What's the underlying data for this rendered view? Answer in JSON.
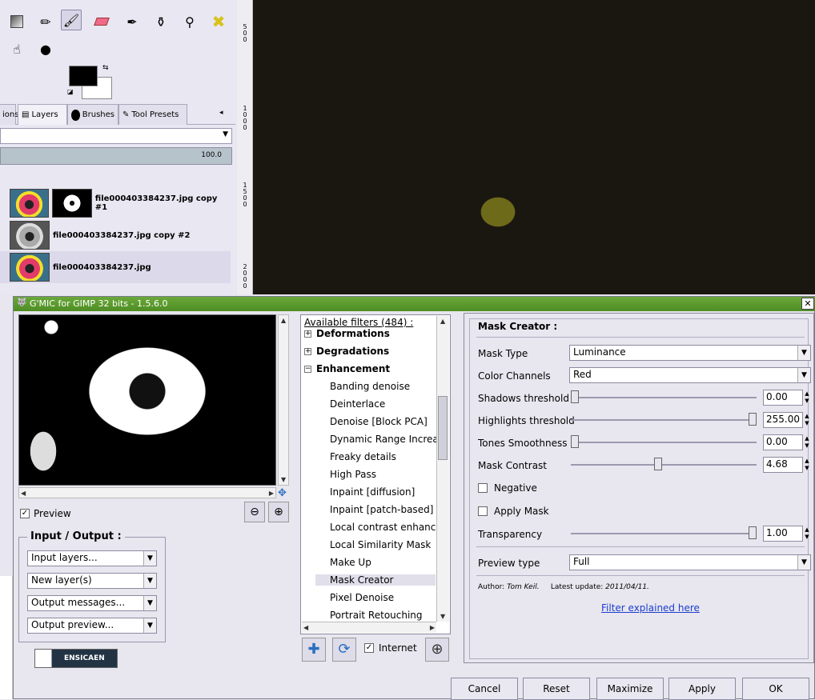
{
  "gimp": {
    "dock_tabs": [
      {
        "label": "ions",
        "icon": "ions-tab-icon"
      },
      {
        "label": "Layers",
        "icon": "layers-icon"
      },
      {
        "label": "Brushes",
        "icon": "brush-icon"
      },
      {
        "label": "Tool Presets",
        "icon": "tool-presets-icon"
      }
    ],
    "opacity": "100.0",
    "layers": [
      {
        "name": "file000403384237.jpg copy #1"
      },
      {
        "name": "file000403384237.jpg copy #2"
      },
      {
        "name": "file000403384237.jpg"
      }
    ],
    "ruler_labels": [
      "5\n0\n0",
      "1\n0\n0\n0",
      "1\n5\n0\n0",
      "2\n0\n0\n0"
    ]
  },
  "gmic": {
    "title": "G'MIC for GIMP 32 bits - 1.5.6.0",
    "close_label": "✕",
    "preview_label": "Preview",
    "io_title": "Input / Output :",
    "io_combos": [
      "Input layers...",
      "New layer(s)",
      "Output messages...",
      "Output preview..."
    ],
    "logo_text": "ENSICAEN",
    "filters_header": "Available filters (484) :",
    "categories": [
      {
        "label": "Deformations",
        "expander": "+"
      },
      {
        "label": "Degradations",
        "expander": "+"
      },
      {
        "label": "Enhancement",
        "expander": "−"
      }
    ],
    "filter_items": [
      "Banding denoise",
      "Deinterlace",
      "Denoise [Block PCA]",
      "Dynamic Range Increase",
      "Freaky details",
      "High Pass",
      "Inpaint [diffusion]",
      "Inpaint [patch-based]",
      "Local contrast enhancen",
      "Local Similarity Mask",
      "Make Up",
      "Mask Creator",
      "Pixel Denoise",
      "Portrait Retouching"
    ],
    "selected_filter": "Mask Creator",
    "internet_label": "Internet",
    "params_title": "Mask Creator :",
    "params": {
      "mask_type": {
        "label": "Mask Type",
        "value": "Luminance"
      },
      "color_channels": {
        "label": "Color Channels",
        "value": "Red"
      },
      "shadows": {
        "label": "Shadows threshold",
        "value": "0.00",
        "fraction": 0.0
      },
      "highlights": {
        "label": "Highlights threshold",
        "value": "255.00",
        "fraction": 1.0
      },
      "tones": {
        "label": "Tones Smoothness",
        "value": "0.00",
        "fraction": 0.0
      },
      "contrast": {
        "label": "Mask Contrast",
        "value": "4.68",
        "fraction": 0.47
      },
      "negative": {
        "label": "Negative",
        "checked": false
      },
      "apply_mask": {
        "label": "Apply Mask",
        "checked": false
      },
      "transparency": {
        "label": "Transparency",
        "value": "1.00",
        "fraction": 1.0
      },
      "preview_type": {
        "label": "Preview type",
        "value": "Full"
      }
    },
    "author_label": "Author:",
    "author": "Tom Keil.",
    "update_label": "Latest update:",
    "update": "2011/04/11.",
    "filter_link": "Filter explained here",
    "buttons": {
      "cancel": "Cancel",
      "reset": "Reset",
      "maximize": "Maximize",
      "apply": "Apply",
      "ok": "OK"
    }
  }
}
